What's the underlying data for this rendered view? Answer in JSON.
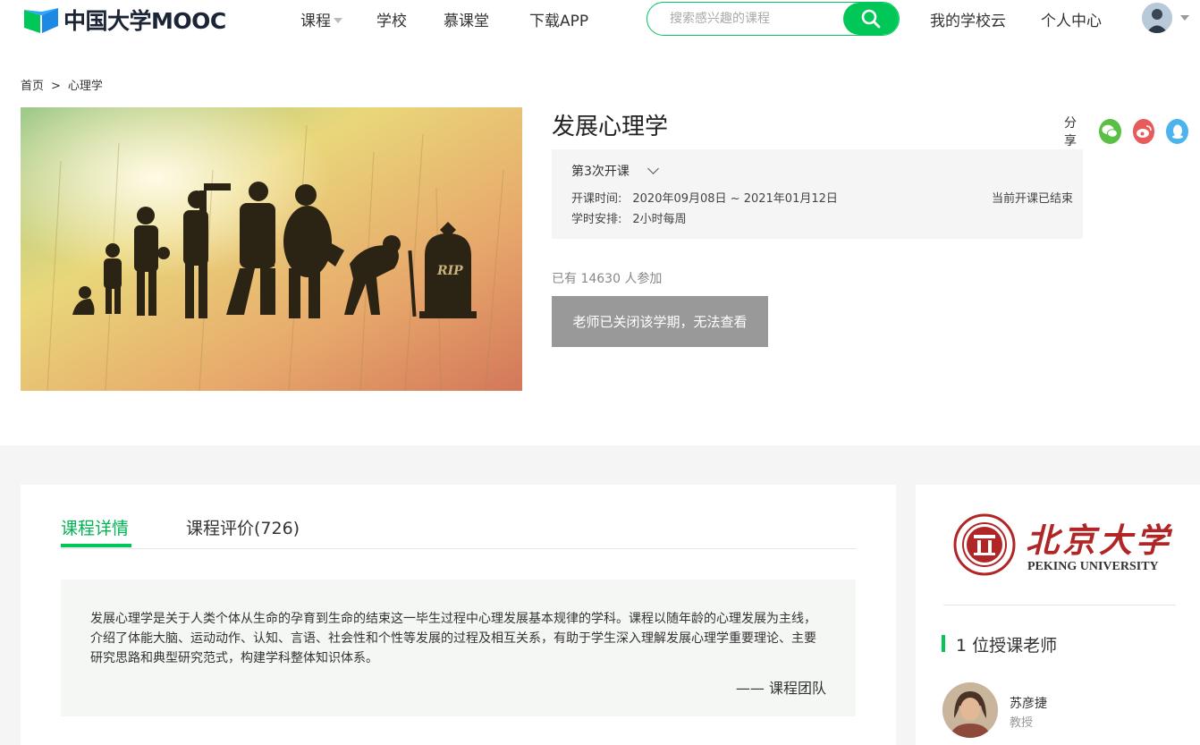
{
  "header": {
    "logo_text": "中国大学MOOC",
    "nav": [
      {
        "label": "课程",
        "has_dropdown": true
      },
      {
        "label": "学校"
      },
      {
        "label": "慕课堂"
      },
      {
        "label": "下载APP"
      }
    ],
    "search": {
      "placeholder": "搜索感兴趣的课程",
      "icon": "search-icon"
    },
    "links": [
      "我的学校云",
      "个人中心"
    ],
    "accent": "#00c758"
  },
  "breadcrumb": {
    "home": "首页",
    "separator": ">",
    "current": "心理学"
  },
  "course": {
    "title": "发展心理学",
    "share_label": "分享",
    "share_icons": [
      "wechat-icon",
      "weibo-icon",
      "qq-icon"
    ],
    "term": {
      "selected": "第3次开课",
      "time_label": "开课时间:",
      "time_value": "2020年09月08日 ~ 2021年01月12日",
      "schedule_label": "学时安排:",
      "schedule_value": "2小时每周",
      "status": "当前开课已结束"
    },
    "enrollment": "已有 14630 人参加",
    "closed_button": "老师已关闭该学期，无法查看"
  },
  "tabs": [
    {
      "label": "课程详情",
      "active": true
    },
    {
      "label": "课程评价(726)",
      "active": false
    }
  ],
  "description": {
    "text": "发展心理学是关于人类个体从生命的孕育到生命的结束这一毕生过程中心理发展基本规律的学科。课程以随年龄的心理发展为主线，介绍了体能大脑、运动动作、认知、言语、社会性和个性等发展的过程及相互关系，有助于学生深入理解发展心理学重要理论、主要研究思路和典型研究范式，构建学科整体知识体系。",
    "signature": "—— 课程团队"
  },
  "sidebar": {
    "school_cn": "北京大学",
    "school_en": "PEKING UNIVERSITY",
    "teachers_heading": "1 位授课老师",
    "teachers": [
      {
        "name": "苏彦捷",
        "title": "教授"
      }
    ]
  }
}
